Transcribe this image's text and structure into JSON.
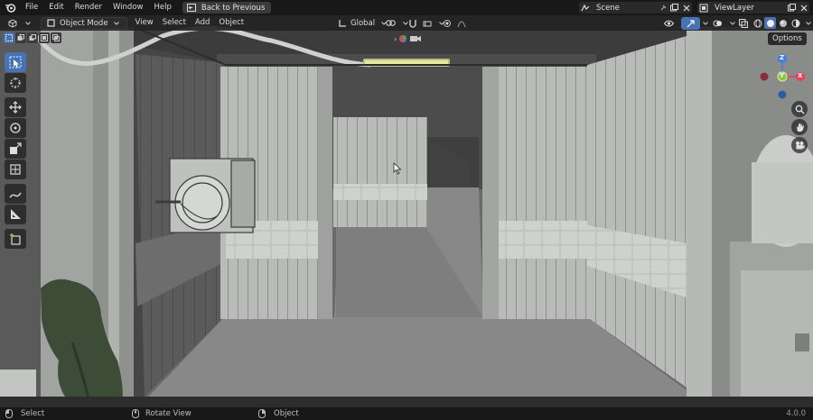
{
  "topbar": {
    "menus": [
      "File",
      "Edit",
      "Render",
      "Window",
      "Help"
    ],
    "back_label": "Back to Previous",
    "scene_name": "Scene",
    "view_layer_name": "ViewLayer"
  },
  "header": {
    "mode_label": "Object Mode",
    "menus": [
      "View",
      "Select",
      "Add",
      "Object"
    ],
    "orientation_label": "Global"
  },
  "options_label": "Options",
  "toolbar": {
    "tools": [
      "select-box-tool",
      "cursor-tool",
      "move-tool",
      "rotate-tool",
      "scale-tool",
      "transform-tool",
      "annotate-tool",
      "measure-tool",
      "add-cube-tool"
    ],
    "active": "select-box-tool"
  },
  "gizmo": {
    "x_label": "X",
    "y_label": "Y",
    "z_label": "Z"
  },
  "statusbar": {
    "select_label": "Select",
    "rotate_label": "Rotate View",
    "object_label": "Object",
    "version": "4.0.0"
  },
  "colors": {
    "accent": "#4772b3",
    "x_axis": "#e8425a",
    "y_axis": "#8bc53f",
    "z_axis": "#3f7fe0"
  }
}
